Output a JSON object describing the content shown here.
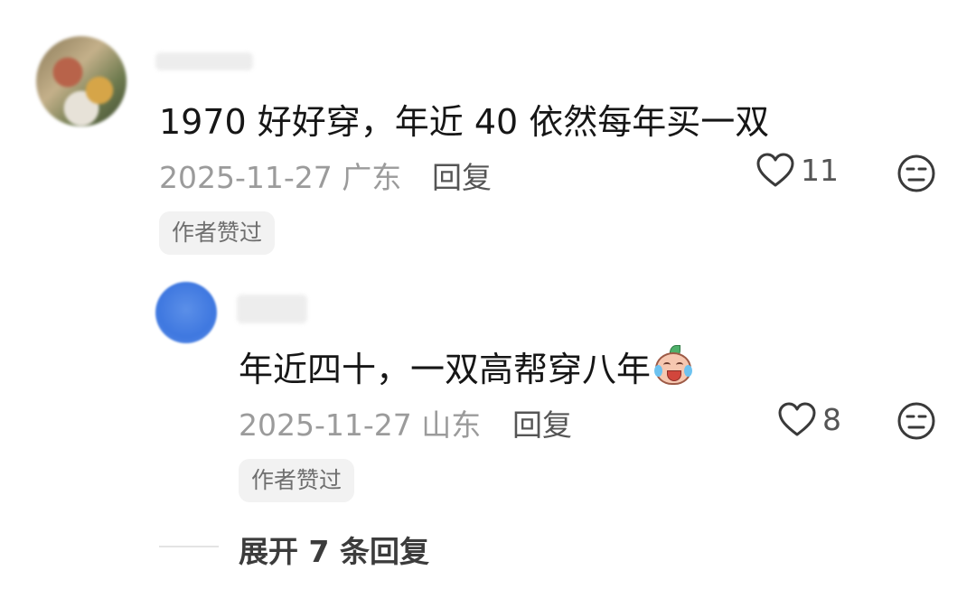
{
  "comment": {
    "text": "1970 好好穿，年近 40 依然每年买一双",
    "date": "2025-11-27",
    "location": "广东",
    "reply_label": "回复",
    "likes": "11",
    "author_badge": "作者赞过"
  },
  "reply": {
    "text": "年近四十，一双高帮穿八年",
    "emoji": "crying-laughing-emoji",
    "date": "2025-11-27",
    "location": "山东",
    "reply_label": "回复",
    "likes": "8",
    "author_badge": "作者赞过"
  },
  "expand_label": "展开 7 条回复",
  "icons": {
    "like": "heart-icon",
    "dislike": "dislike-face-icon"
  },
  "colors": {
    "text": "#161616",
    "meta": "#9b9b9b",
    "badge_bg": "#f2f2f2"
  }
}
